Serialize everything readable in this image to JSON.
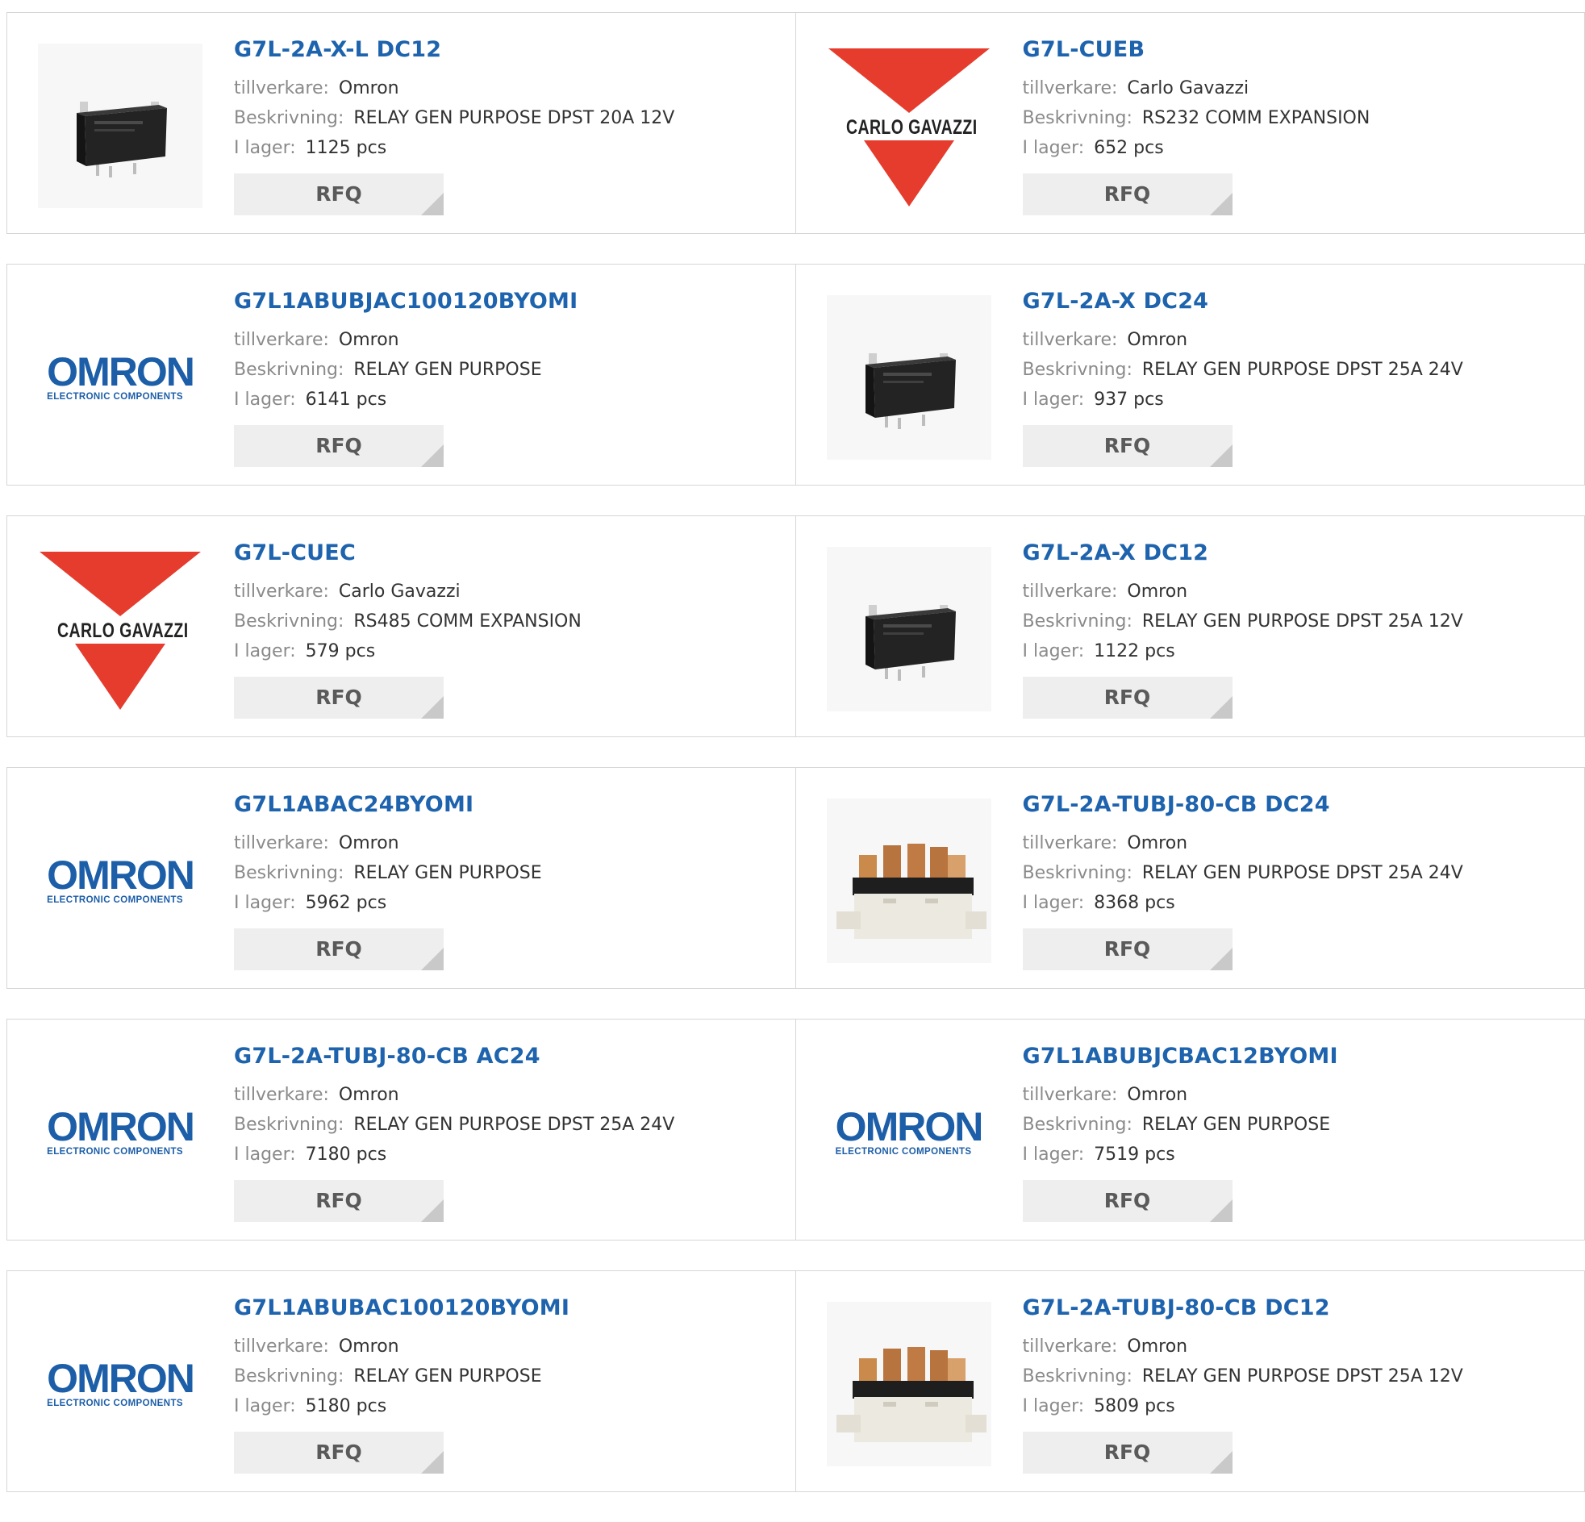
{
  "labels": {
    "manufacturer": "tillverkare:",
    "description": "Beskrivning:",
    "stock": "I lager:",
    "rfq": "RFQ"
  },
  "products": [
    {
      "part": "G7L-2A-X-L DC12",
      "manufacturer": "Omron",
      "description": "RELAY GEN PURPOSE DPST 20A 12V",
      "stock": "1125 pcs",
      "image": "relay-small-black"
    },
    {
      "part": "G7L-CUEB",
      "manufacturer": "Carlo Gavazzi",
      "description": "RS232 COMM EXPANSION",
      "stock": "652 pcs",
      "image": "carlo-gavazzi-logo",
      "logo_text": "CARLO GAVAZZI"
    },
    {
      "part": "G7L1ABUBJAC100120BYOMI",
      "manufacturer": "Omron",
      "description": "RELAY GEN PURPOSE",
      "stock": "6141 pcs",
      "image": "omron-logo",
      "logo_text": "OMRON",
      "logo_subtext": "ELECTRONIC COMPONENTS"
    },
    {
      "part": "G7L-2A-X DC24",
      "manufacturer": "Omron",
      "description": "RELAY GEN PURPOSE DPST 25A 24V",
      "stock": "937 pcs",
      "image": "relay-small-black"
    },
    {
      "part": "G7L-CUEC",
      "manufacturer": "Carlo Gavazzi",
      "description": "RS485 COMM EXPANSION",
      "stock": "579 pcs",
      "image": "carlo-gavazzi-logo",
      "logo_text": "CARLO GAVAZZI"
    },
    {
      "part": "G7L-2A-X DC12",
      "manufacturer": "Omron",
      "description": "RELAY GEN PURPOSE DPST 25A 12V",
      "stock": "1122 pcs",
      "image": "relay-small-black"
    },
    {
      "part": "G7L1ABAC24BYOMI",
      "manufacturer": "Omron",
      "description": "RELAY GEN PURPOSE",
      "stock": "5962 pcs",
      "image": "omron-logo",
      "logo_text": "OMRON",
      "logo_subtext": "ELECTRONIC COMPONENTS"
    },
    {
      "part": "G7L-2A-TUBJ-80-CB DC24",
      "manufacturer": "Omron",
      "description": "RELAY GEN PURPOSE DPST 25A 24V",
      "stock": "8368 pcs",
      "image": "relay-large-white"
    },
    {
      "part": "G7L-2A-TUBJ-80-CB AC24",
      "manufacturer": "Omron",
      "description": "RELAY GEN PURPOSE DPST 25A 24V",
      "stock": "7180 pcs",
      "image": "omron-logo",
      "logo_text": "OMRON",
      "logo_subtext": "ELECTRONIC COMPONENTS"
    },
    {
      "part": "G7L1ABUBJCBAC12BYOMI",
      "manufacturer": "Omron",
      "description": "RELAY GEN PURPOSE",
      "stock": "7519 pcs",
      "image": "omron-logo",
      "logo_text": "OMRON",
      "logo_subtext": "ELECTRONIC COMPONENTS"
    },
    {
      "part": "G7L1ABUBAC100120BYOMI",
      "manufacturer": "Omron",
      "description": "RELAY GEN PURPOSE",
      "stock": "5180 pcs",
      "image": "omron-logo",
      "logo_text": "OMRON",
      "logo_subtext": "ELECTRONIC COMPONENTS"
    },
    {
      "part": "G7L-2A-TUBJ-80-CB DC12",
      "manufacturer": "Omron",
      "description": "RELAY GEN PURPOSE DPST 25A 12V",
      "stock": "5809 pcs",
      "image": "relay-large-white"
    }
  ],
  "colors": {
    "link": "#1e63ad",
    "label": "#8a8a8a",
    "value": "#333333",
    "button_bg": "#eeeeee",
    "border": "#d6d6d6",
    "gavazzi_red": "#e53c2e",
    "omron_blue": "#1c5ea8"
  }
}
